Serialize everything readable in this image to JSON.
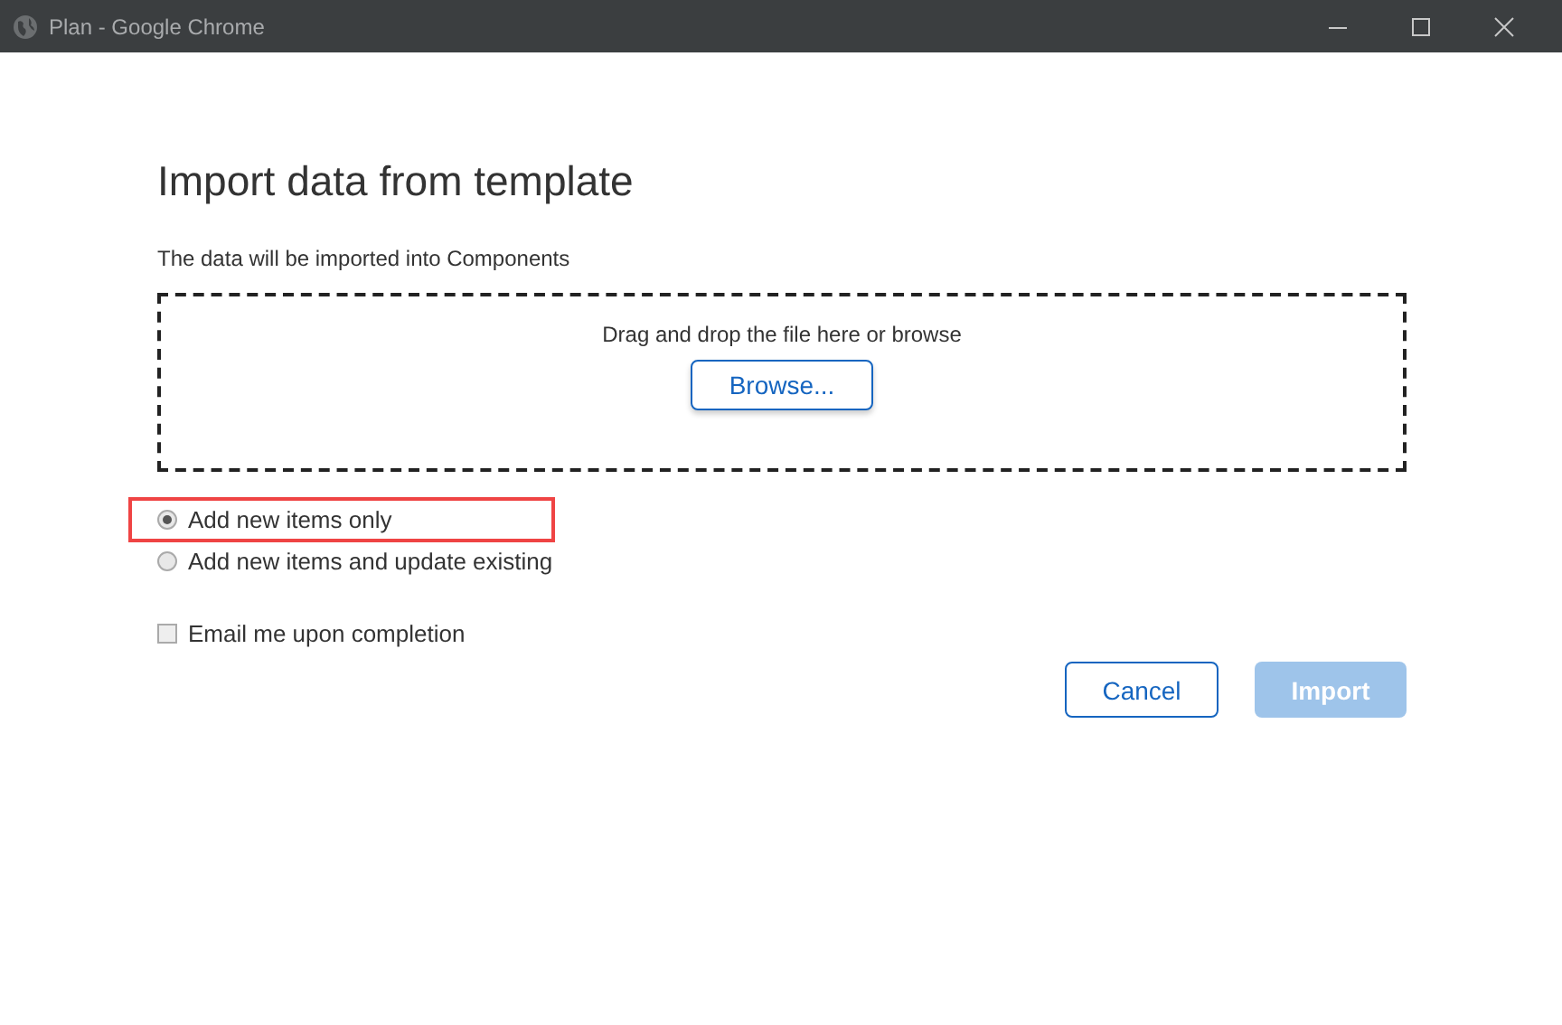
{
  "window": {
    "title": "Plan - Google Chrome"
  },
  "dialog": {
    "title": "Import data from template",
    "subtitle": "The data will be imported into Components",
    "dropzone": {
      "hint": "Drag and drop the file here or browse",
      "button": "Browse..."
    },
    "options": [
      {
        "label": "Add new items only",
        "selected": true,
        "highlighted": true
      },
      {
        "label": "Add new items and update existing",
        "selected": false,
        "highlighted": false
      }
    ],
    "email": {
      "label": "Email me upon completion",
      "checked": false
    },
    "buttons": [
      {
        "label": "Cancel",
        "kind": "secondary",
        "disabled": false
      },
      {
        "label": "Import",
        "kind": "primary",
        "disabled": true
      }
    ]
  }
}
